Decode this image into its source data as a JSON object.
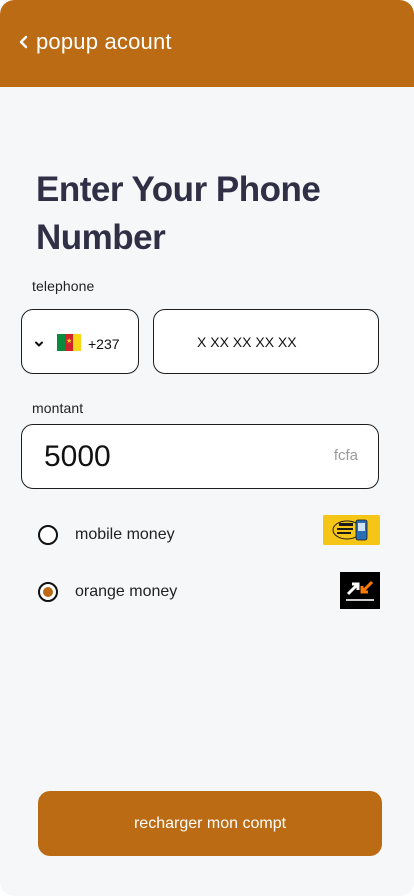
{
  "header": {
    "title": "popup acount",
    "back_icon": "chevron-left-icon"
  },
  "page": {
    "title": "Enter Your Phone Number"
  },
  "phone": {
    "label": "telephone",
    "country_code": "+237",
    "country_flag": "cameroon-flag-icon",
    "placeholder": "X XX XX XX XX"
  },
  "amount": {
    "label": "montant",
    "value": "5000",
    "currency": "fcfa"
  },
  "payment_options": [
    {
      "label": "mobile money",
      "selected": false,
      "logo": "mtn-mobile-money-logo"
    },
    {
      "label": "orange money",
      "selected": true,
      "logo": "orange-money-logo"
    }
  ],
  "submit": {
    "label": "recharger mon compt"
  },
  "colors": {
    "accent": "#bb6b14",
    "background": "#f6f7f9",
    "title": "#2f2f45"
  }
}
